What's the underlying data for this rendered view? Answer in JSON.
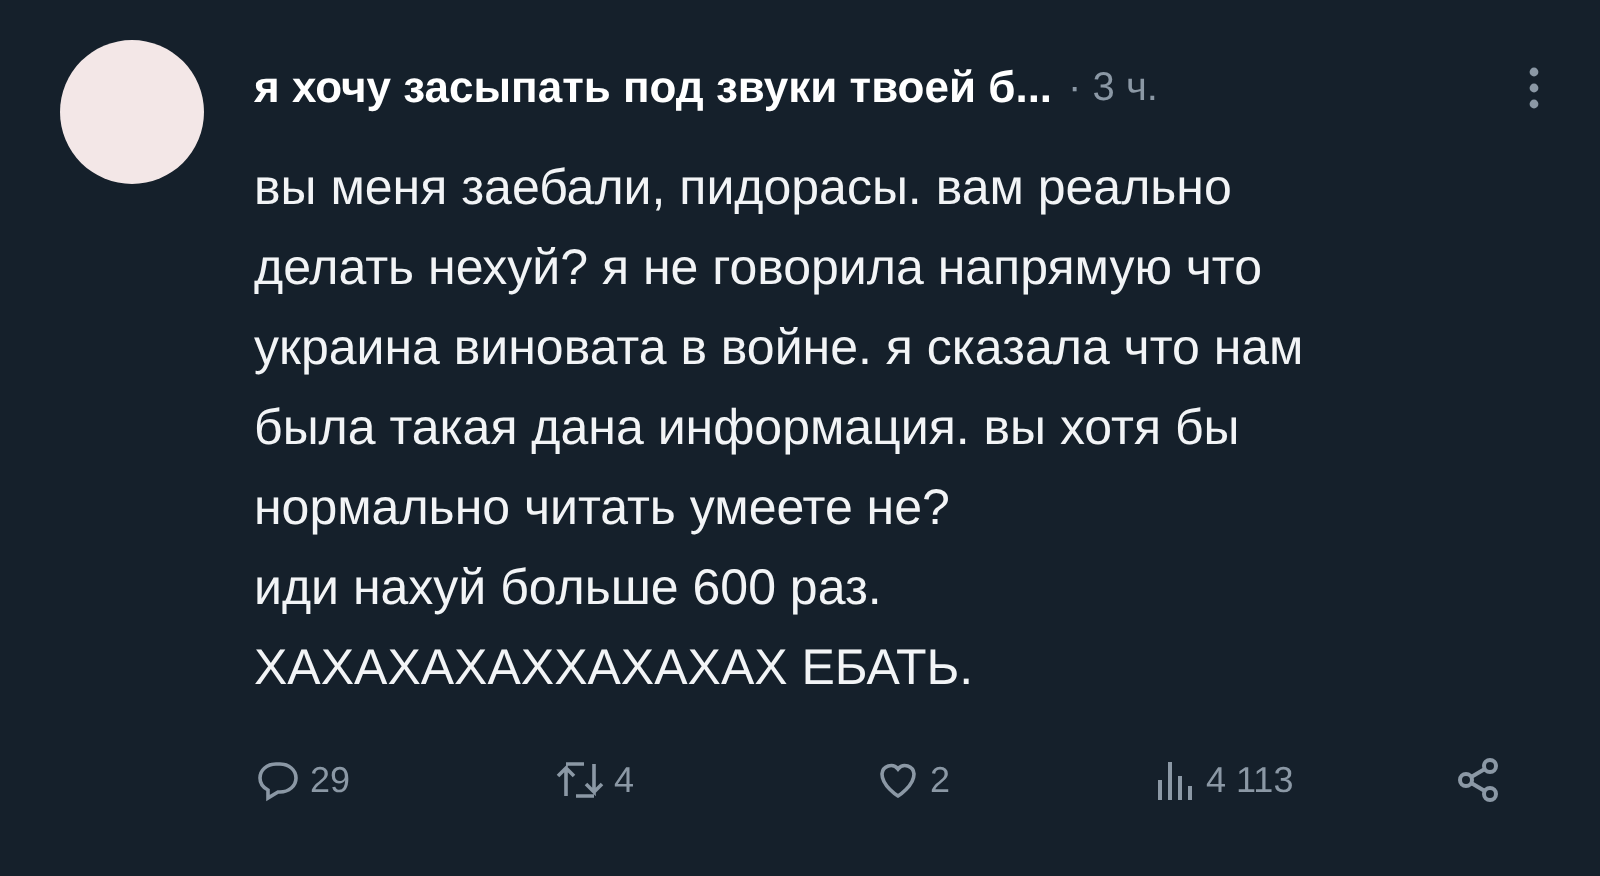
{
  "post": {
    "author": "я хочу засыпать под звуки твоей б...",
    "separator": "·",
    "time": "3 ч.",
    "lines": [
      "вы меня заебали, пидорасы. вам реально",
      "делать нехуй? я не говорила напрямую что",
      "украина виновата в войне. я сказала что нам",
      "была такая дана информация. вы хотя бы",
      "нормально читать умеете не?",
      "иди нахуй больше 600 раз.",
      "ХАХАХАХАХХАХАХАХ ЕБАТЬ."
    ]
  },
  "actions": [
    {
      "kind": "reply",
      "count": "29"
    },
    {
      "kind": "repost",
      "count": "4"
    },
    {
      "kind": "like",
      "count": "2"
    },
    {
      "kind": "views",
      "count": "4 113"
    },
    {
      "kind": "share"
    }
  ]
}
